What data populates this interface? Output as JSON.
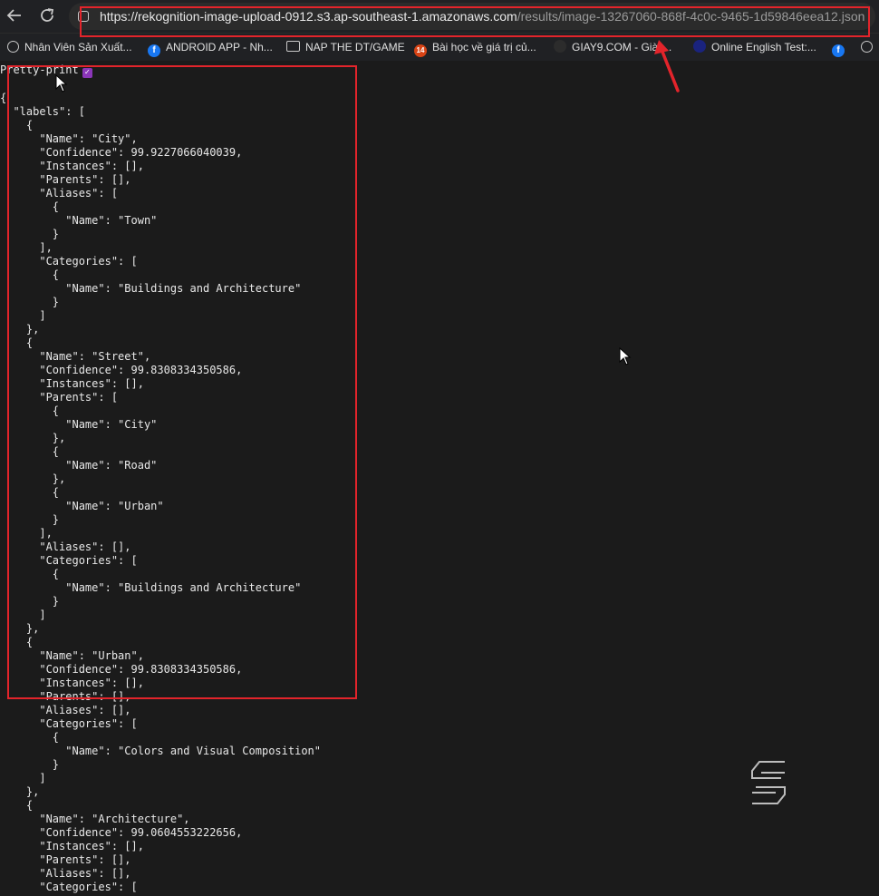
{
  "browser": {
    "back_icon": "arrow-left-icon",
    "reload_icon": "reload-icon",
    "url_host": "https://rekognition-image-upload-0912.s3.ap-southeast-1.amazonaws.com",
    "url_path": "/results/image-13267060-868f-4c0c-9465-1d59846eea12.json"
  },
  "bookmarks": [
    {
      "icon": "globe-icon",
      "label": "Nhân Viên Sản Xuất..."
    },
    {
      "icon": "facebook-icon",
      "label": "ANDROID APP - Nh..."
    },
    {
      "icon": "folder-icon",
      "label": "NAP THE DT/GAME"
    },
    {
      "icon": "badge-14-icon",
      "label": "Bài học về giá trị củ..."
    },
    {
      "icon": "giay9-icon",
      "label": "GIAY9.COM - Giày..."
    },
    {
      "icon": "globe-icon",
      "label": "Online English Test:..."
    },
    {
      "icon": "facebook-icon",
      "label": ""
    },
    {
      "icon": "globe-icon",
      "label": ""
    }
  ],
  "pretty_print": {
    "label": "Pretty-print",
    "checked": true
  },
  "annotation_color": "#e3242b",
  "json_lines": [
    "{",
    "  \"labels\": [",
    "    {",
    "      \"Name\": \"City\",",
    "      \"Confidence\": 99.9227066040039,",
    "      \"Instances\": [],",
    "      \"Parents\": [],",
    "      \"Aliases\": [",
    "        {",
    "          \"Name\": \"Town\"",
    "        }",
    "      ],",
    "      \"Categories\": [",
    "        {",
    "          \"Name\": \"Buildings and Architecture\"",
    "        }",
    "      ]",
    "    },",
    "    {",
    "      \"Name\": \"Street\",",
    "      \"Confidence\": 99.8308334350586,",
    "      \"Instances\": [],",
    "      \"Parents\": [",
    "        {",
    "          \"Name\": \"City\"",
    "        },",
    "        {",
    "          \"Name\": \"Road\"",
    "        },",
    "        {",
    "          \"Name\": \"Urban\"",
    "        }",
    "      ],",
    "      \"Aliases\": [],",
    "      \"Categories\": [",
    "        {",
    "          \"Name\": \"Buildings and Architecture\"",
    "        }",
    "      ]",
    "    },",
    "    {",
    "      \"Name\": \"Urban\",",
    "      \"Confidence\": 99.8308334350586,",
    "      \"Instances\": [],",
    "      \"Parents\": [],",
    "      \"Aliases\": [],",
    "      \"Categories\": [",
    "        {",
    "          \"Name\": \"Colors and Visual Composition\"",
    "        }",
    "      ]",
    "    },",
    "    {",
    "      \"Name\": \"Architecture\",",
    "      \"Confidence\": 99.0604553222656,",
    "      \"Instances\": [],",
    "      \"Parents\": [],",
    "      \"Aliases\": [],",
    "      \"Categories\": ["
  ]
}
